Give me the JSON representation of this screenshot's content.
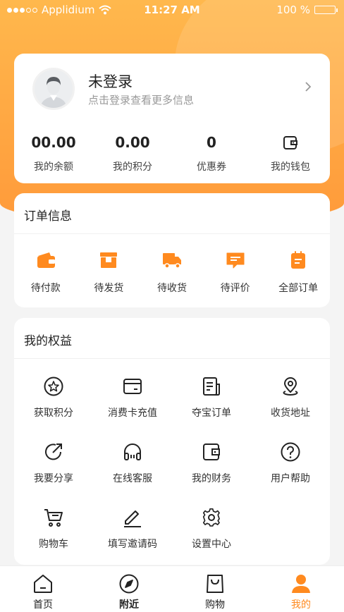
{
  "status_bar": {
    "carrier": "Applidium",
    "time": "11:27 AM",
    "battery": "100 %"
  },
  "profile": {
    "name": "未登录",
    "subtitle": "点击登录查看更多信息",
    "avatar_icon": "user-avatar-icon",
    "stats": [
      {
        "value": "00.00",
        "label": "我的余额"
      },
      {
        "value": "0.00",
        "label": "我的积分"
      },
      {
        "value": "0",
        "label": "优惠券"
      },
      {
        "value_icon": "wallet-icon",
        "label": "我的钱包"
      }
    ]
  },
  "orders": {
    "title": "订单信息",
    "items": [
      {
        "label": "待付款",
        "icon": "wallet-icon"
      },
      {
        "label": "待发货",
        "icon": "box-icon"
      },
      {
        "label": "待收货",
        "icon": "truck-icon"
      },
      {
        "label": "待评价",
        "icon": "comment-icon"
      },
      {
        "label": "全部订单",
        "icon": "clipboard-icon"
      }
    ]
  },
  "benefits": {
    "title": "我的权益",
    "items": [
      {
        "label": "获取积分",
        "icon": "star-circle-icon"
      },
      {
        "label": "消费卡充值",
        "icon": "card-icon"
      },
      {
        "label": "夺宝订单",
        "icon": "document-icon"
      },
      {
        "label": "收货地址",
        "icon": "location-pin-icon"
      },
      {
        "label": "我要分享",
        "icon": "share-icon"
      },
      {
        "label": "在线客服",
        "icon": "headset-icon"
      },
      {
        "label": "我的财务",
        "icon": "wallet-outline-icon"
      },
      {
        "label": "用户帮助",
        "icon": "help-icon"
      },
      {
        "label": "购物车",
        "icon": "cart-icon"
      },
      {
        "label": "填写邀请码",
        "icon": "pen-icon"
      },
      {
        "label": "设置中心",
        "icon": "gear-icon"
      }
    ]
  },
  "tabs": [
    {
      "label": "首页",
      "icon": "home-icon"
    },
    {
      "label": "附近",
      "icon": "compass-icon"
    },
    {
      "label": "购物",
      "icon": "shopping-bag-icon"
    },
    {
      "label": "我的",
      "icon": "person-icon",
      "active": true
    }
  ],
  "colors": {
    "accent": "#ff8a1f",
    "hero_top": "#ffb84d",
    "hero_bottom": "#ff9a3a"
  }
}
